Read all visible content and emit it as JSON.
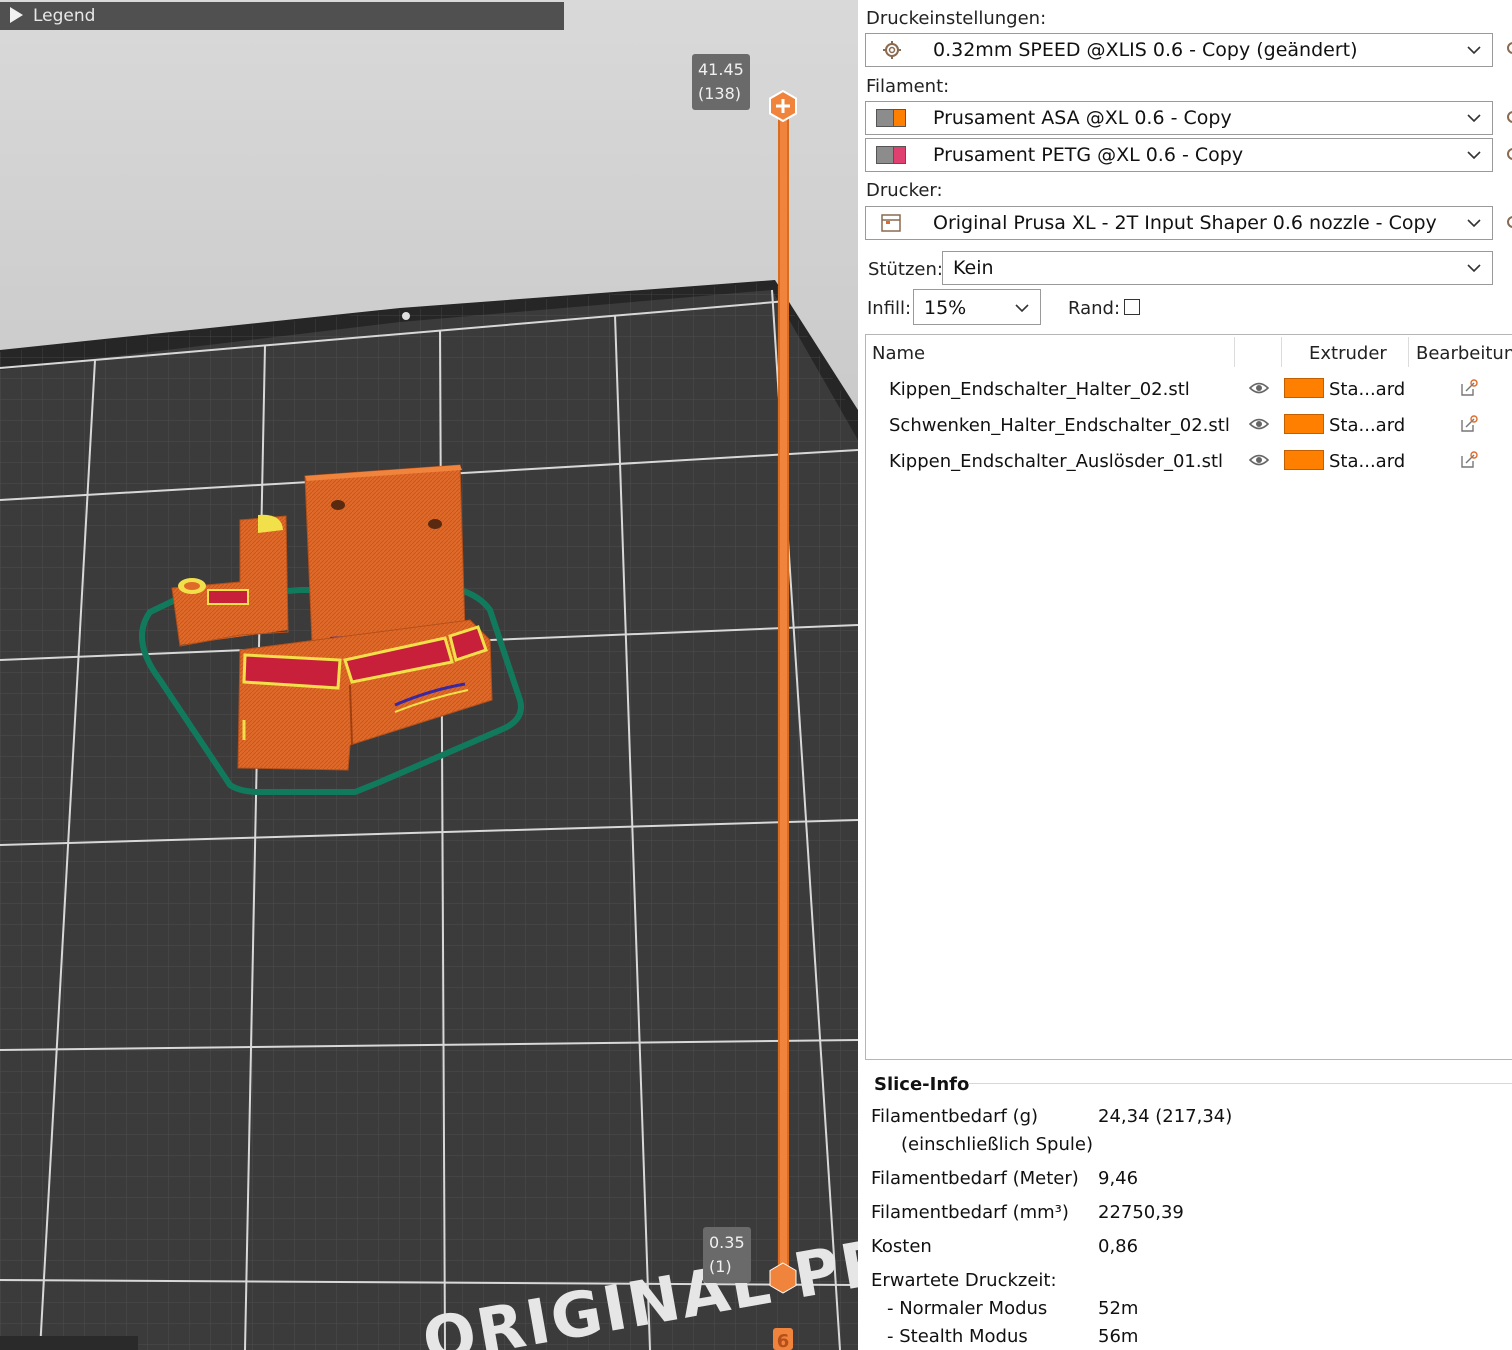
{
  "viewport": {
    "legend_label": "Legend",
    "slider_top": {
      "height": "41.45",
      "layer": "(138)"
    },
    "slider_bottom": {
      "height": "0.35",
      "layer": "(1)"
    },
    "bed_brand_text": "ORIGINAL PRU",
    "colors": {
      "part_orange": "#e06a2a",
      "perimeter_yellow": "#f2e04a",
      "infill_red": "#c8203a",
      "skirt_green": "#127a5c",
      "bed": "#3a3a3a",
      "slider": "#f0843c"
    }
  },
  "sidebar": {
    "print_settings": {
      "label": "Druckeinstellungen:",
      "value": "0.32mm SPEED @XLIS 0.6 - Copy (geändert)",
      "icon": "cog-icon"
    },
    "filament": {
      "label": "Filament:",
      "items": [
        {
          "value": "Prusament ASA @XL 0.6 - Copy",
          "color": "#ff8000"
        },
        {
          "value": "Prusament PETG @XL 0.6 - Copy",
          "color": "#e04070"
        }
      ]
    },
    "printer": {
      "label": "Drucker:",
      "value": "Original Prusa XL - 2T Input Shaper 0.6 nozzle - Copy",
      "icon": "printer-icon"
    },
    "supports": {
      "label": "Stützen:",
      "value": "Kein"
    },
    "infill": {
      "label": "Infill:",
      "value": "15%"
    },
    "brim": {
      "label": "Rand:",
      "checked": false
    },
    "object_list": {
      "columns": {
        "name": "Name",
        "extruder": "Extruder",
        "editing": "Bearbeitung"
      },
      "rows": [
        {
          "name": "Kippen_Endschalter_Halter_02.stl",
          "extruder": "Sta...ard",
          "color": "#ff8000"
        },
        {
          "name": "Schwenken_Halter_Endschalter_02.stl",
          "extruder": "Sta...ard",
          "color": "#ff8000"
        },
        {
          "name": "Kippen_Endschalter_Auslösder_01.stl",
          "extruder": "Sta...ard",
          "color": "#ff8000"
        }
      ]
    },
    "slice_info": {
      "title": "Slice-Info",
      "filament_g_label": "Filamentbedarf (g)",
      "filament_g_sub": "(einschließlich Spule)",
      "filament_g_value": "24,34 (217,34)",
      "filament_m_label": "Filamentbedarf (Meter)",
      "filament_m_value": "9,46",
      "filament_mm3_label": "Filamentbedarf (mm³)",
      "filament_mm3_value": "22750,39",
      "cost_label": "Kosten",
      "cost_value": "0,86",
      "time_label": "Erwartete Druckzeit:",
      "normal_label": "- Normaler Modus",
      "normal_value": "52m",
      "stealth_label": "- Stealth Modus",
      "stealth_value": "56m"
    }
  }
}
